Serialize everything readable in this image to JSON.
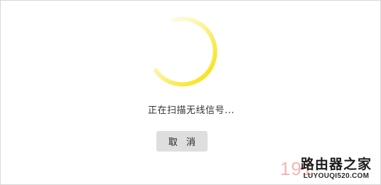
{
  "dialog": {
    "status_text": "正在扫描无线信号...",
    "cancel_label": "取 消",
    "accent_color": "#f7e51f"
  },
  "watermark": {
    "number": "191",
    "title": "路由器之家",
    "url": "LUYOUQI520.COM"
  }
}
